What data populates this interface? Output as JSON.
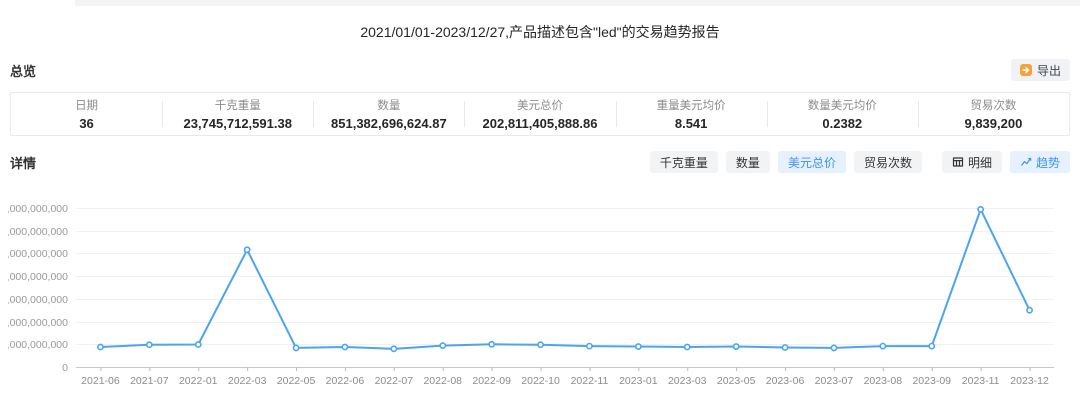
{
  "title": "2021/01/01-2023/12/27,产品描述包含\"led\"的交易趋势报告",
  "overview": {
    "heading": "总览",
    "export_button": {
      "label": "导出",
      "icon": "export-arrow-icon",
      "icon_color": "#f6a23c"
    },
    "columns": [
      {
        "label": "日期",
        "value": "36"
      },
      {
        "label": "千克重量",
        "value": "23,745,712,591.38"
      },
      {
        "label": "数量",
        "value": "851,382,696,624.87"
      },
      {
        "label": "美元总价",
        "value": "202,811,405,888.86"
      },
      {
        "label": "重量美元均价",
        "value": "8.541"
      },
      {
        "label": "数量美元均价",
        "value": "0.2382"
      },
      {
        "label": "贸易次数",
        "value": "9,839,200"
      }
    ]
  },
  "details": {
    "heading": "详情",
    "metric_buttons": [
      {
        "label": "千克重量",
        "selected": false
      },
      {
        "label": "数量",
        "selected": false
      },
      {
        "label": "美元总价",
        "selected": true
      },
      {
        "label": "贸易次数",
        "selected": false
      }
    ],
    "view_buttons": [
      {
        "label": "明细",
        "icon": "table-icon",
        "selected": false
      },
      {
        "label": "趋势",
        "icon": "line-chart-icon",
        "selected": true
      }
    ]
  },
  "colors": {
    "accent_blue": "#3d94f2",
    "selected_bg": "#e6f1fd",
    "button_bg": "#f2f3f5",
    "line": "#4da3f0",
    "grid_line": "#eef2f8",
    "axis_line": "#c8c8c8",
    "tick_label": "#8c8c8c"
  },
  "chart_data": {
    "type": "line",
    "categories": [
      "2021-06",
      "2021-07",
      "2022-01",
      "2022-03",
      "2022-05",
      "2022-06",
      "2022-07",
      "2022-08",
      "2022-09",
      "2022-10",
      "2022-11",
      "2023-01",
      "2023-03",
      "2023-05",
      "2023-06",
      "2023-07",
      "2023-08",
      "2023-09",
      "2023-11",
      "2023-12"
    ],
    "values": [
      4400000000,
      4900000000,
      4950000000,
      25800000000,
      4200000000,
      4400000000,
      4000000000,
      4700000000,
      5000000000,
      4900000000,
      4600000000,
      4500000000,
      4400000000,
      4500000000,
      4300000000,
      4200000000,
      4600000000,
      4600000000,
      34700000000,
      12500000000
    ],
    "title": "",
    "xlabel": "",
    "ylabel": "",
    "ylim": [
      0,
      35000000000
    ],
    "ytick_step": 5000000000,
    "grid": true,
    "legend": false,
    "line_color": "#4da3f0",
    "marker": "hollow-circle"
  }
}
